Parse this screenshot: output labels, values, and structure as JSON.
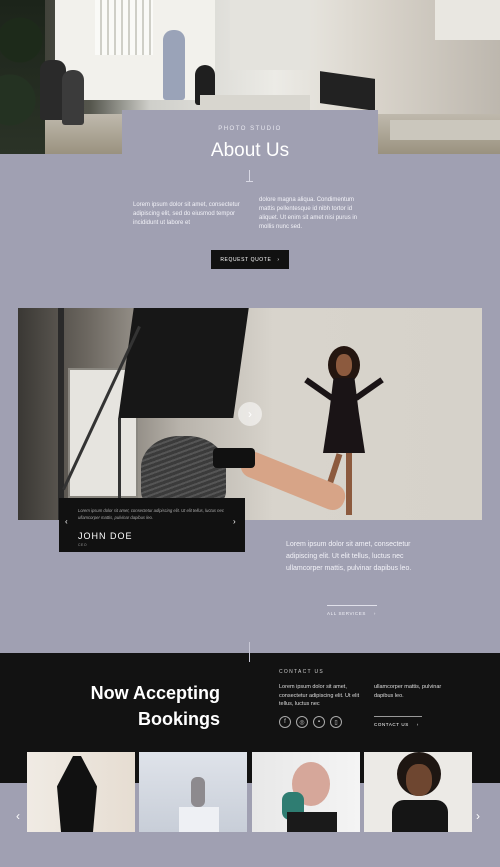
{
  "about": {
    "eyebrow": "PHOTO STUDIO",
    "title": "About Us",
    "col_left": "Lorem ipsum dolor sit amet, consectetur adipiscing elit, sed do eiusmod tempor incididunt ut labore et",
    "col_right": "dolore magna aliqua. Condimentum mattis pellentesque id nibh tortor id aliquet. Ut enim sit amet nisi purus in mollis nunc sed.",
    "button_label": "REQUEST QUOTE"
  },
  "testimonial": {
    "text": "Lorem ipsum dolor sit amet, consectetur adipiscing elit. Ut elit tellus, luctus nec ullamcorper mattis, pulvinar dapibus leo.",
    "name": "JOHN DOE",
    "role": "CEO",
    "prev": "‹",
    "next": "›"
  },
  "studio": {
    "text": "Lorem ipsum dolor sit amet, consectetur adipiscing elit. Ut elit tellus, luctus nec ullamcorper mattis, pulvinar dapibus leo.",
    "link_label": "ALL SERVICES"
  },
  "bookings": {
    "title_line1": "Now Accepting",
    "title_line2": "Bookings",
    "contact_eyebrow": "CONTACT US",
    "contact_left": "Lorem ipsum dolor sit amet, consectetur adipiscing elit. Ut elit tellus, luctus nec",
    "contact_right": "ullamcorper mattis, pulvinar dapibus leo.",
    "contact_link": "CONTACT US",
    "socials": [
      "facebook-icon",
      "instagram-icon",
      "linkedin-icon",
      "phone-icon"
    ]
  },
  "gallery": {
    "prev": "‹",
    "next": "›"
  },
  "icons": {
    "arrow_right": "›",
    "play": "›"
  },
  "colors": {
    "background": "#a0a0b2",
    "dark": "#121212"
  }
}
